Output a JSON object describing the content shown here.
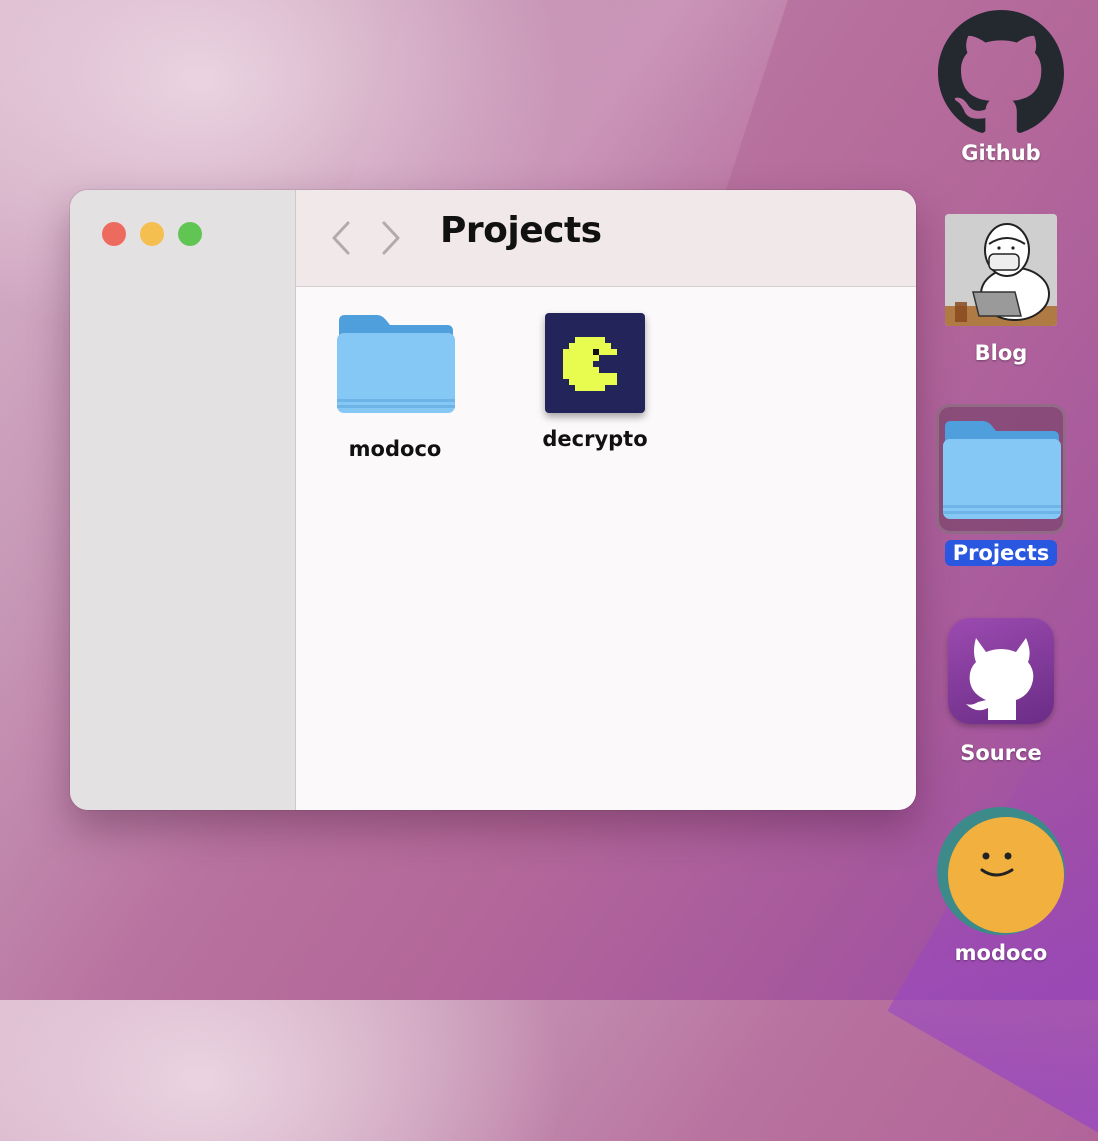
{
  "window": {
    "title": "Projects",
    "items": [
      {
        "label": "modoco",
        "icon": "folder-icon"
      },
      {
        "label": "decrypto",
        "icon": "pacman-icon"
      }
    ]
  },
  "desktop": {
    "icons": [
      {
        "label": "Github",
        "icon": "github-icon"
      },
      {
        "label": "Blog",
        "icon": "blog-thumbnail-icon"
      },
      {
        "label": "Projects",
        "icon": "folder-icon",
        "selected": true
      },
      {
        "label": "Source",
        "icon": "github-desktop-icon"
      },
      {
        "label": "modoco",
        "icon": "smiley-avatar-icon"
      }
    ]
  },
  "colors": {
    "selection": "#2a57e0",
    "folder": "#86c8f5",
    "pacman": "#e8fb4f",
    "close": "#ed6a5e",
    "minimize": "#f4bf4f",
    "maximize": "#61c554"
  }
}
